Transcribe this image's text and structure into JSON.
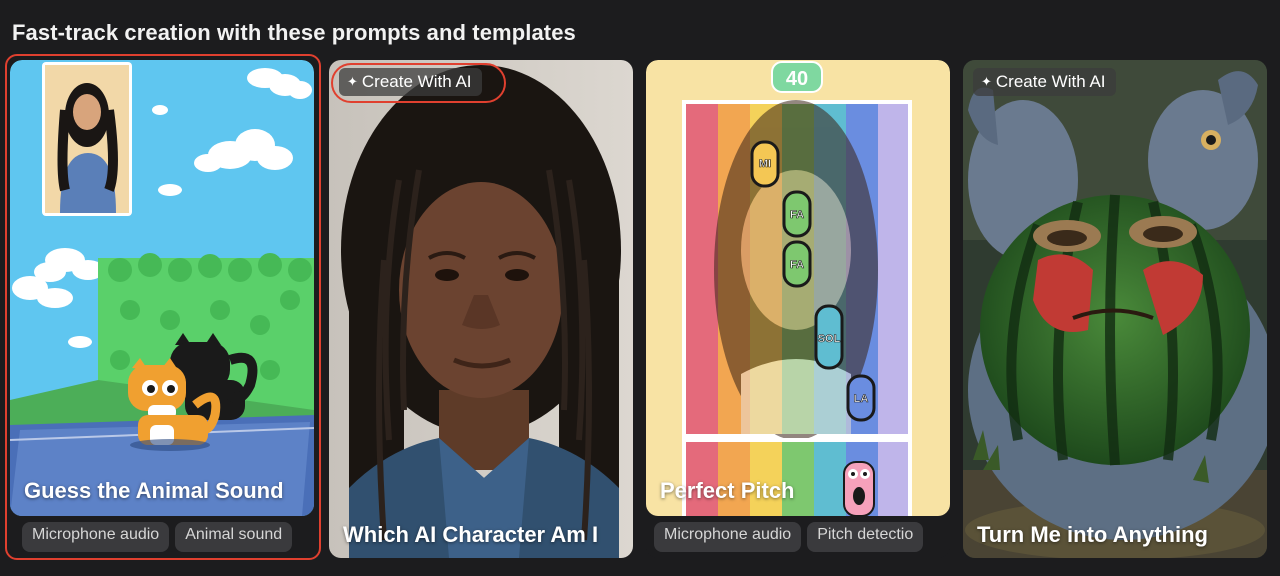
{
  "section": {
    "title": "Fast-track creation with these prompts and templates"
  },
  "cards": [
    {
      "title": "Guess the Animal Sound",
      "tags": [
        "Microphone audio",
        "Animal sound"
      ]
    },
    {
      "badge": "Create With AI",
      "title": "Which AI Character Am I"
    },
    {
      "counter": "40",
      "title": "Perfect Pitch",
      "tags": [
        "Microphone audio",
        "Pitch detectio"
      ],
      "notes": [
        "MI",
        "FA",
        "FA",
        "SOL",
        "LA"
      ]
    },
    {
      "badge": "Create With AI",
      "title": "Turn Me into Anything"
    }
  ],
  "colors": {
    "background": "#1c1c1e",
    "highlight": "#e0402f",
    "tag_bg": "#3a3a3d"
  }
}
